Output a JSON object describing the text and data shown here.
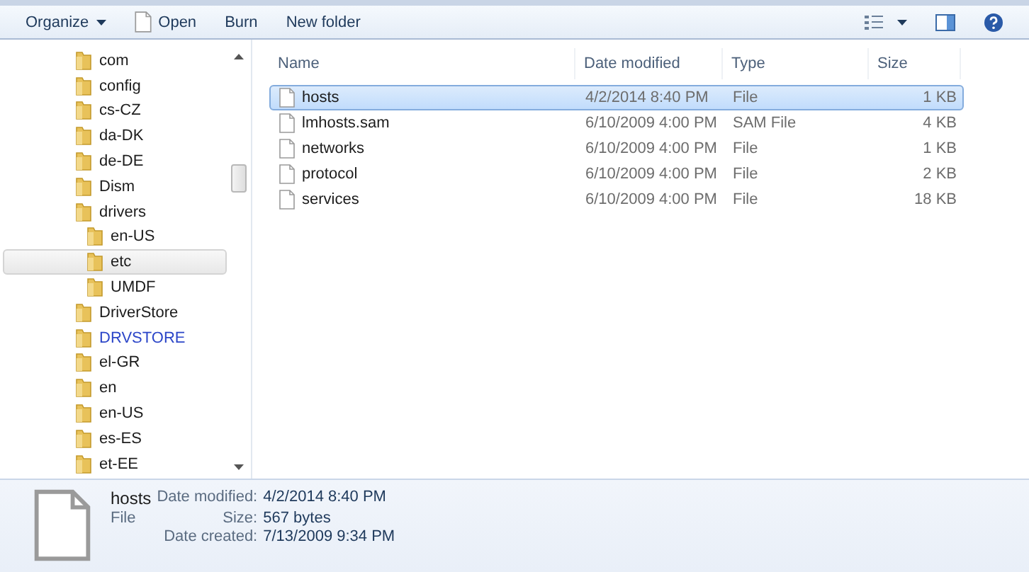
{
  "toolbar": {
    "buttons": [
      {
        "label": "Organize",
        "kind": "menu"
      },
      {
        "label": "Open",
        "kind": "file"
      },
      {
        "label": "Burn",
        "kind": "plain"
      },
      {
        "label": "New folder",
        "kind": "plain"
      }
    ]
  },
  "tree": {
    "items": [
      {
        "label": "com",
        "selected": false,
        "compressed": false
      },
      {
        "label": "config",
        "selected": false,
        "compressed": false
      },
      {
        "label": "cs-CZ",
        "selected": false,
        "compressed": false
      },
      {
        "label": "da-DK",
        "selected": false,
        "compressed": false
      },
      {
        "label": "de-DE",
        "selected": false,
        "compressed": false
      },
      {
        "label": "Dism",
        "selected": false,
        "compressed": false
      },
      {
        "label": "drivers",
        "selected": false,
        "compressed": false,
        "children": [
          {
            "label": "en-US",
            "selected": false,
            "compressed": false
          },
          {
            "label": "etc",
            "selected": true,
            "compressed": false
          },
          {
            "label": "UMDF",
            "selected": false,
            "compressed": false
          }
        ]
      },
      {
        "label": "DriverStore",
        "selected": false,
        "compressed": false
      },
      {
        "label": "DRVSTORE",
        "selected": false,
        "compressed": true
      },
      {
        "label": "el-GR",
        "selected": false,
        "compressed": false
      },
      {
        "label": "en",
        "selected": false,
        "compressed": false
      },
      {
        "label": "en-US",
        "selected": false,
        "compressed": false
      },
      {
        "label": "es-ES",
        "selected": false,
        "compressed": false
      },
      {
        "label": "et-EE",
        "selected": false,
        "compressed": false
      }
    ]
  },
  "table": {
    "columns": [
      "Name",
      "Date modified",
      "Type",
      "Size"
    ],
    "rows": [
      {
        "name": "hosts",
        "date": "4/2/2014 8:40 PM",
        "type": "File",
        "size": "1 KB",
        "selected": true
      },
      {
        "name": "lmhosts.sam",
        "date": "6/10/2009 4:00 PM",
        "type": "SAM File",
        "size": "4 KB",
        "selected": false
      },
      {
        "name": "networks",
        "date": "6/10/2009 4:00 PM",
        "type": "File",
        "size": "1 KB",
        "selected": false
      },
      {
        "name": "protocol",
        "date": "6/10/2009 4:00 PM",
        "type": "File",
        "size": "2 KB",
        "selected": false
      },
      {
        "name": "services",
        "date": "6/10/2009 4:00 PM",
        "type": "File",
        "size": "18 KB",
        "selected": false
      }
    ]
  },
  "details": {
    "name": "hosts",
    "type": "File",
    "fields": [
      {
        "label": "Date modified:",
        "value": "4/2/2014 8:40 PM"
      },
      {
        "label": "Size:",
        "value": "567 bytes"
      },
      {
        "label": "Date created:",
        "value": "7/13/2009 9:34 PM"
      }
    ]
  }
}
